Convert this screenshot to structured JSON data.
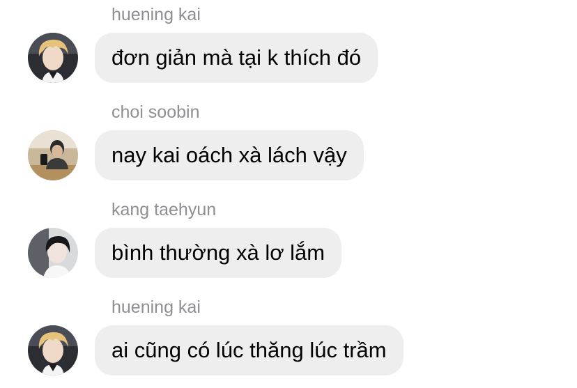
{
  "messages": [
    {
      "sender": "huening kai",
      "text": "đơn giản mà tại k thích đó",
      "avatar": "avatar-blonde-hair"
    },
    {
      "sender": "choi soobin",
      "text": "nay kai oách xà lách vậy",
      "avatar": "avatar-mirror-selfie"
    },
    {
      "sender": "kang taehyun",
      "text": "bình thường xà lơ lắm",
      "avatar": "avatar-dark-hair"
    },
    {
      "sender": "huening kai",
      "text": "ai cũng có lúc thăng lúc trầm",
      "avatar": "avatar-blonde-hair"
    }
  ],
  "colors": {
    "bubble": "#eeeeef",
    "sender_name": "#8e8e93",
    "message_text": "#000000"
  }
}
